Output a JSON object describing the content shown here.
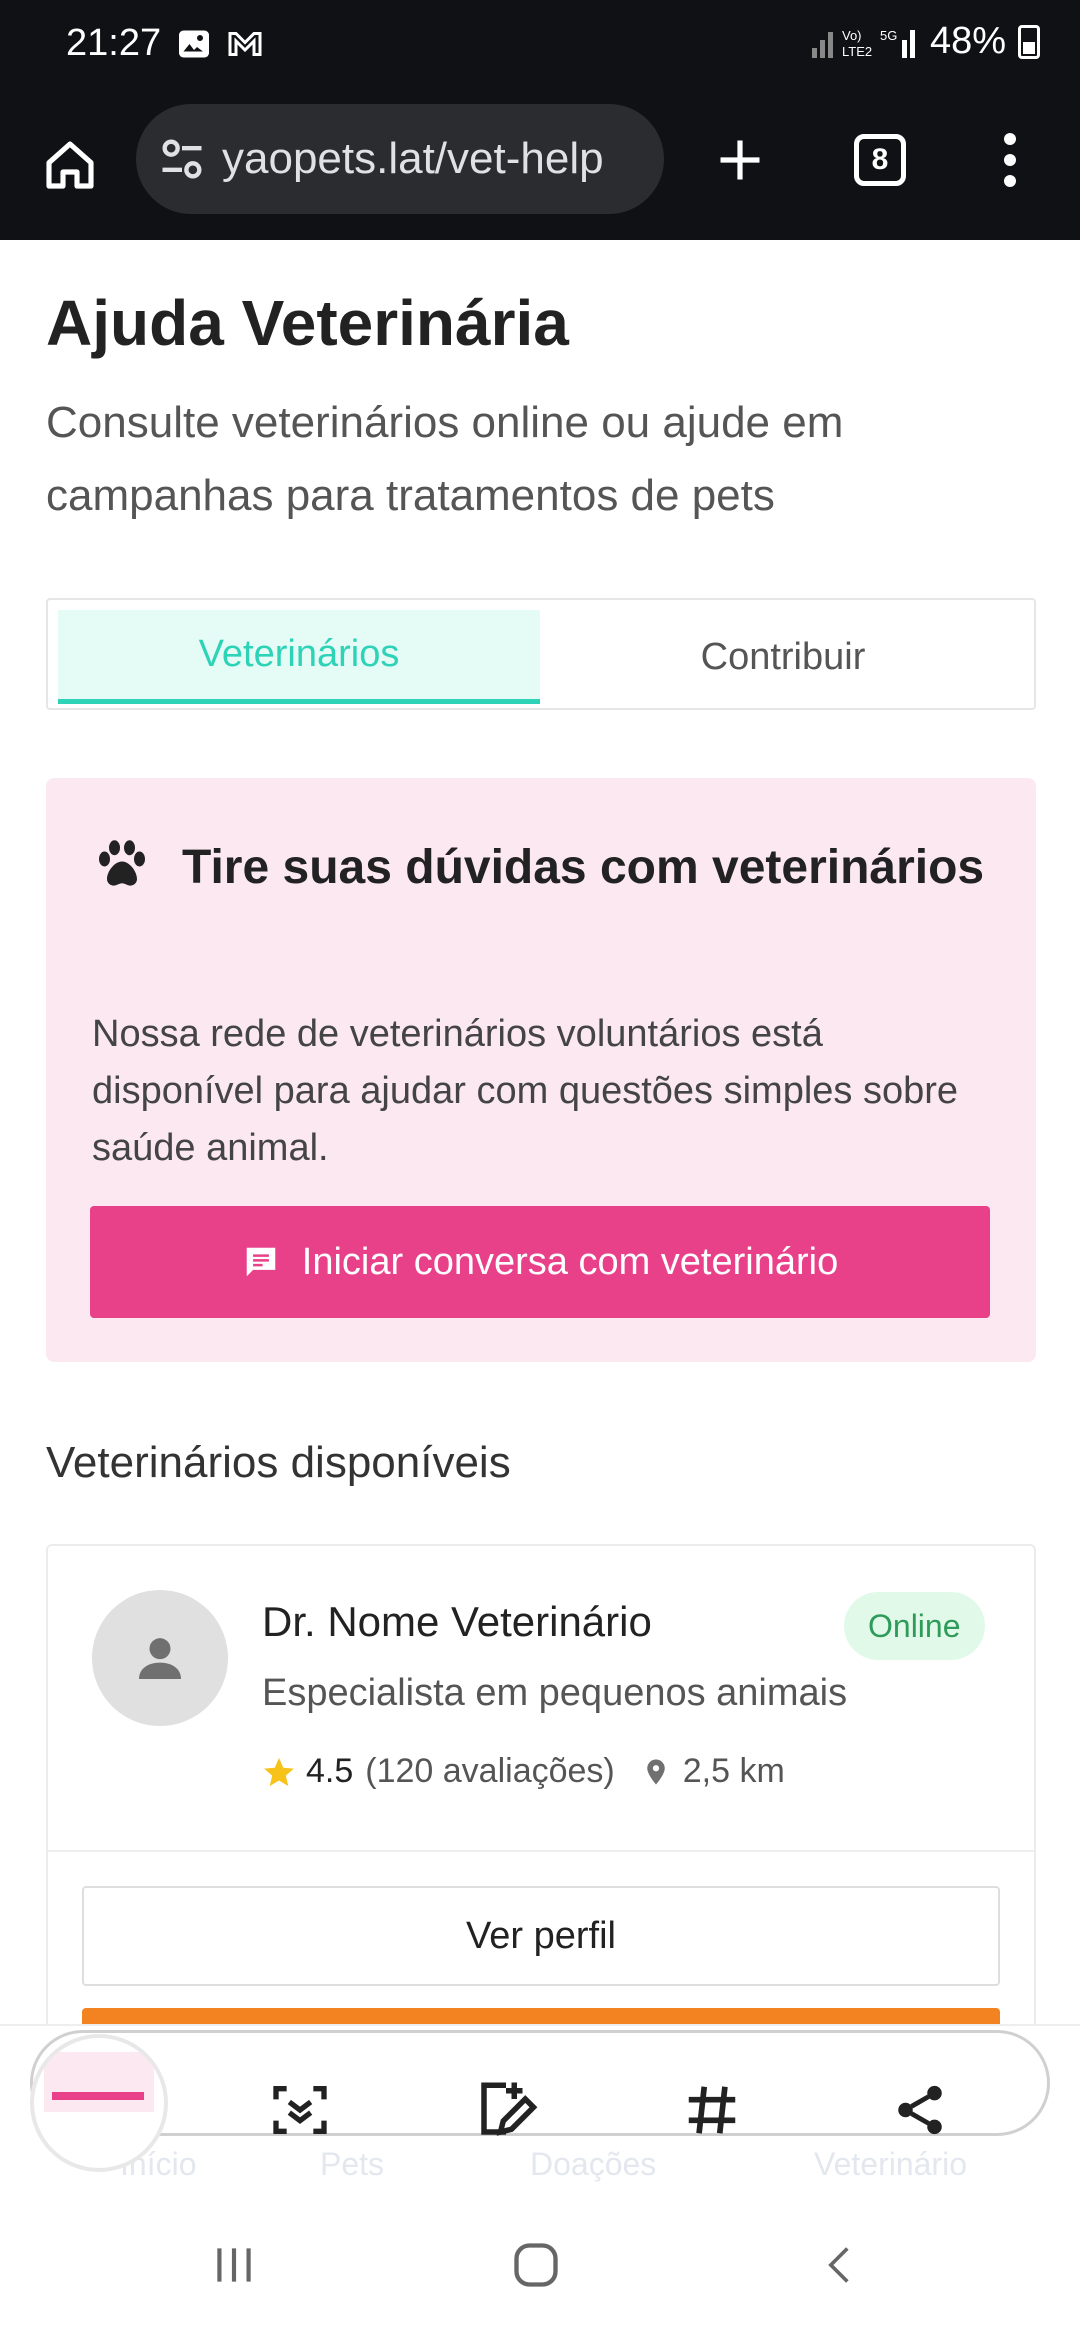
{
  "status_bar": {
    "time": "21:27",
    "battery": "48%"
  },
  "browser": {
    "url": "yaopets.lat/vet-help",
    "tab_count": "8"
  },
  "page": {
    "title": "Ajuda Veterinária",
    "subtitle": "Consulte veterinários online ou ajude em campanhas para tratamentos de pets"
  },
  "tabs": [
    {
      "label": "Veterinários",
      "active": true
    },
    {
      "label": "Contribuir",
      "active": false
    }
  ],
  "promo": {
    "title": "Tire suas dúvidas com veterinários",
    "text": "Nossa rede de veterinários voluntários está disponível para ajudar com questões simples sobre saúde animal.",
    "button_label": "Iniciar conversa com veterinário"
  },
  "section": {
    "title": "Veterinários disponíveis"
  },
  "vet": {
    "name": "Dr. Nome Veterinário",
    "status": "Online",
    "specialty": "Especialista em pequenos animais",
    "rating": "4.5",
    "reviews": "(120 avaliações)",
    "distance": "2,5 km",
    "profile_button": "Ver perfil"
  },
  "bottom_nav": {
    "items": [
      "Início",
      "Pets",
      "Doações",
      "Veterinário"
    ]
  },
  "colors": {
    "accent_teal": "#2ed3b7",
    "accent_pink": "#e8418a",
    "promo_bg": "#fbe8f1",
    "online_green": "#2e9b5a",
    "orange": "#f38321"
  },
  "icons": {
    "home": "home-icon",
    "site_settings": "tune-icon",
    "new_tab": "plus-icon",
    "menu": "more-vert-icon",
    "paw": "paw-icon",
    "chat": "chat-icon",
    "person": "person-icon",
    "star": "star-icon",
    "location": "location-pin-icon",
    "scan": "scan-icon",
    "edit": "edit-icon",
    "hashtag": "hashtag-icon",
    "share": "share-icon"
  }
}
